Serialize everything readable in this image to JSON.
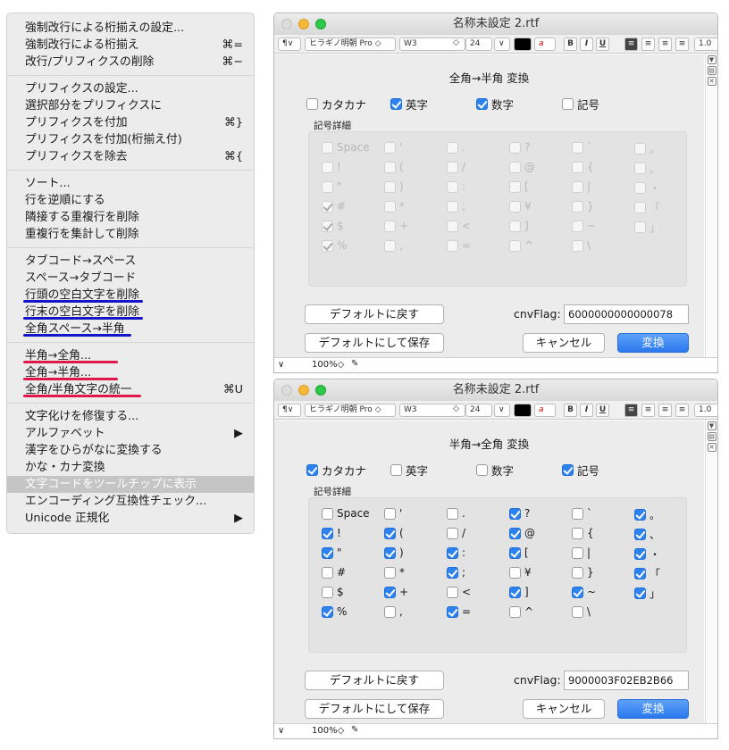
{
  "menu": {
    "items": [
      {
        "label": "強制改行による桁揃えの設定...",
        "shortcut": ""
      },
      {
        "label": "強制改行による桁揃え",
        "shortcut": "⌘="
      },
      {
        "label": "改行/プリフィクスの削除",
        "shortcut": "⌘−"
      },
      {
        "sep": true
      },
      {
        "label": "プリフィクスの設定...",
        "shortcut": ""
      },
      {
        "label": "選択部分をプリフィクスに",
        "shortcut": ""
      },
      {
        "label": "プリフィクスを付加",
        "shortcut": "⌘}"
      },
      {
        "label": "プリフィクスを付加(桁揃え付)",
        "shortcut": ""
      },
      {
        "label": "プリフィクスを除去",
        "shortcut": "⌘{"
      },
      {
        "sep": true
      },
      {
        "label": "ソート...",
        "shortcut": ""
      },
      {
        "label": "行を逆順にする",
        "shortcut": ""
      },
      {
        "label": "隣接する重複行を削除",
        "shortcut": ""
      },
      {
        "label": "重複行を集計して削除",
        "shortcut": ""
      },
      {
        "sep": true
      },
      {
        "label": "タブコード→スペース",
        "shortcut": ""
      },
      {
        "label": "スペース→タブコード",
        "shortcut": ""
      },
      {
        "label": "行頭の空白文字を削除",
        "shortcut": "",
        "ul": "blue"
      },
      {
        "label": "行末の空白文字を削除",
        "shortcut": "",
        "ul": "blue"
      },
      {
        "label": "全角スペース→半角",
        "shortcut": "",
        "ul": "blue"
      },
      {
        "sep": true
      },
      {
        "label": "半角→全角...",
        "shortcut": "",
        "ul": "red"
      },
      {
        "label": "全角→半角...",
        "shortcut": "",
        "ul": "red"
      },
      {
        "label": "全角/半角文字の統一",
        "shortcut": "⌘U",
        "ul": "red"
      },
      {
        "sep": true
      },
      {
        "label": "文字化けを修復する...",
        "shortcut": ""
      },
      {
        "label": "アルファベット",
        "shortcut": "▶"
      },
      {
        "label": "漢字をひらがなに変換する",
        "shortcut": ""
      },
      {
        "label": "かな・カナ変換",
        "shortcut": ""
      },
      {
        "label": "文字コードをツールチップに表示",
        "shortcut": "",
        "hl": true
      },
      {
        "label": "エンコーディング互換性チェック...",
        "shortcut": ""
      },
      {
        "label": "Unicode 正規化",
        "shortcut": "▶"
      }
    ]
  },
  "toolbar": {
    "para": "¶∨",
    "font": "ヒラギノ明朝 Pro",
    "weight": "W3",
    "size": "24",
    "bold": "B",
    "italic": "I",
    "underline": "U",
    "spacing": "1.0"
  },
  "zoom": "100%",
  "grp_label": "記号詳細",
  "btn_default": "デフォルトに戻す",
  "btn_save": "デフォルトにして保存",
  "btn_cancel": "キャンセル",
  "btn_convert": "変換",
  "flag_label": "cnvFlag:",
  "symbols": [
    "Space",
    "'",
    ".",
    "?",
    "`",
    "。",
    "!",
    "(",
    "/",
    "@",
    "{",
    "、",
    "\"",
    ")",
    ":",
    "[",
    "|",
    "・",
    "#",
    "*",
    ";",
    "¥",
    "}",
    "「",
    "$",
    "+",
    "<",
    "]",
    "~",
    "」",
    "%",
    ",",
    "=",
    "^",
    "\\",
    "",
    "&",
    "-",
    ">",
    "_",
    "",
    ""
  ],
  "w1": {
    "title": "名称未設定 2.rtf",
    "dtitle": "全角→半角 変換",
    "cats": [
      {
        "label": "カタカナ",
        "on": false
      },
      {
        "label": "英字",
        "on": true
      },
      {
        "label": "数字",
        "on": true
      },
      {
        "label": "記号",
        "on": false
      }
    ],
    "flag": "6000000000000078",
    "checks": [
      0,
      0,
      0,
      0,
      0,
      0,
      0,
      0,
      0,
      0,
      0,
      0,
      0,
      0,
      0,
      0,
      0,
      0,
      1,
      0,
      0,
      0,
      0,
      0,
      1,
      0,
      0,
      0,
      0,
      0,
      1,
      0,
      0,
      0,
      0,
      0,
      1,
      0,
      0,
      0,
      0,
      0
    ]
  },
  "w2": {
    "title": "名称未設定 2.rtf",
    "dtitle": "半角→全角 変換",
    "cats": [
      {
        "label": "カタカナ",
        "on": true
      },
      {
        "label": "英字",
        "on": false
      },
      {
        "label": "数字",
        "on": false
      },
      {
        "label": "記号",
        "on": true
      }
    ],
    "flag": "9000003F02EB2B66",
    "checks": [
      0,
      0,
      0,
      1,
      0,
      1,
      1,
      1,
      0,
      1,
      0,
      1,
      1,
      1,
      1,
      1,
      0,
      1,
      0,
      0,
      1,
      0,
      0,
      1,
      0,
      1,
      0,
      1,
      1,
      1,
      1,
      0,
      1,
      0,
      0,
      0,
      1,
      1,
      0,
      0,
      0,
      0
    ]
  }
}
